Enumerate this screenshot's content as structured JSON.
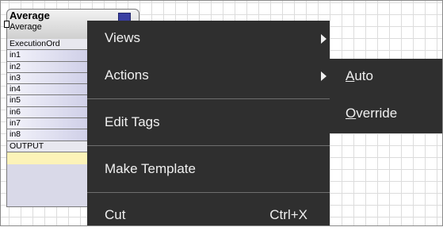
{
  "block": {
    "title": "Average",
    "type": "Average",
    "slots": [
      {
        "label": "ExecutionOrd",
        "kind": "exec"
      },
      {
        "label": "in1",
        "kind": "input"
      },
      {
        "label": "in2",
        "kind": "input"
      },
      {
        "label": "in3",
        "kind": "input"
      },
      {
        "label": "in4",
        "kind": "input"
      },
      {
        "label": "in5",
        "kind": "input"
      },
      {
        "label": "in6",
        "kind": "input"
      },
      {
        "label": "in7",
        "kind": "input"
      },
      {
        "label": "in8",
        "kind": "input"
      },
      {
        "label": "OUTPUT",
        "kind": "output"
      },
      {
        "label": "",
        "kind": "value"
      }
    ]
  },
  "menu": {
    "views": "Views",
    "actions": "Actions",
    "edit_tags": "Edit Tags",
    "make_template": "Make Template",
    "cut": "Cut",
    "cut_shortcut": "Ctrl+X"
  },
  "submenu": {
    "auto_mnemonic": "A",
    "auto_rest": "uto",
    "override_mnemonic": "O",
    "override_rest": "verride"
  },
  "colors": {
    "menu_bg": "#2f2f2f",
    "menu_text": "#f0f0f0",
    "slot_gradient_end": "#b9b9dc",
    "value_slot": "#fcf3b8"
  }
}
